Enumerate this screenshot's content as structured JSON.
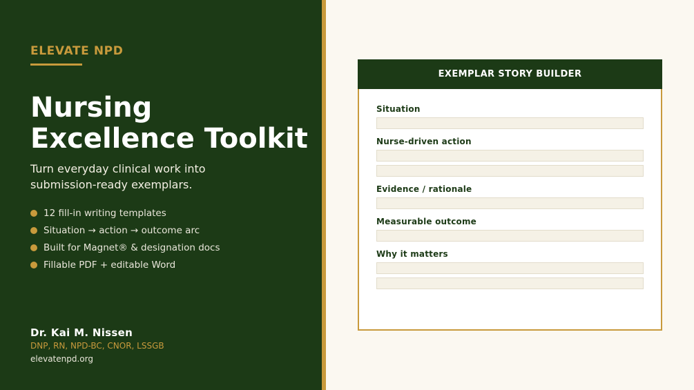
{
  "brand": "ELEVATE NPD",
  "title_lines": [
    "Nursing",
    "Excellence Toolkit"
  ],
  "subtitle_lines": [
    "Turn everyday clinical work into",
    "submission-ready exemplars."
  ],
  "bullets": [
    "12 fill-in writing templates",
    "Situation → action → outcome arc",
    "Built for Magnet® & designation docs",
    "Fillable PDF + editable Word"
  ],
  "author": {
    "name": "Dr. Kai M. Nissen",
    "credentials": "DNP, RN, NPD-BC, CNOR, LSSGB",
    "website": "elevatenpd.org"
  },
  "builder": {
    "header": "EXEMPLAR STORY BUILDER",
    "fields": [
      {
        "label": "Situation"
      },
      {
        "label": "Nurse-driven action"
      },
      {
        "label": "Evidence / rationale"
      },
      {
        "label": "Measurable outcome"
      },
      {
        "label": "Why it matters"
      }
    ]
  },
  "colors": {
    "panel_green": "#1c3a16",
    "accent_gold": "#c89a3c",
    "background_cream": "#fbf8f1",
    "field_fill": "#f5f1e6"
  }
}
